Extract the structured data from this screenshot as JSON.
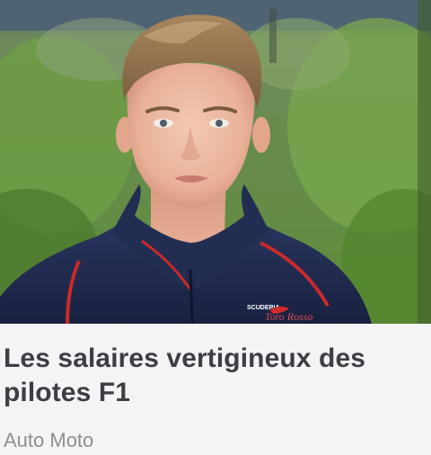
{
  "article": {
    "headline": "Les salaires vertigineux des pilotes F1",
    "category": "Auto Moto",
    "photo": {
      "jacket_brand_top": "SCUDERIA",
      "jacket_brand_bottom": "Toro Rosso"
    }
  },
  "colors": {
    "background": "#f4f4f6",
    "headline": "#3d3d44",
    "category": "#8e8e93",
    "jacket": "#1e2a4e",
    "accent": "#d32b2b"
  }
}
